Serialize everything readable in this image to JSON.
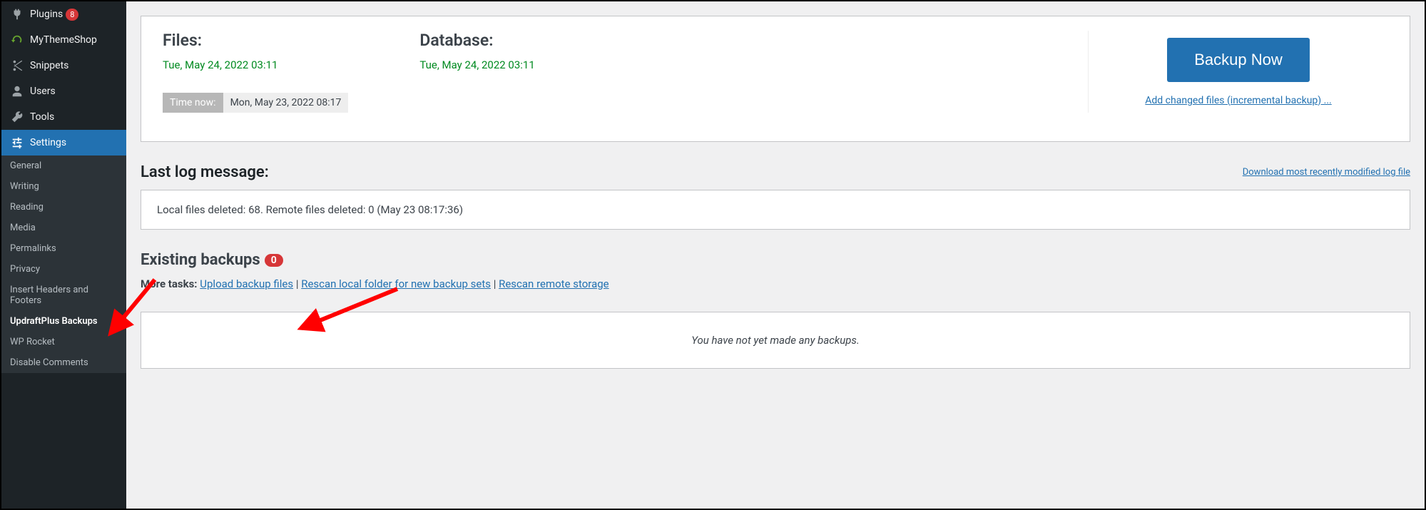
{
  "sidebar": {
    "items": [
      {
        "label": "Plugins",
        "badge": "8",
        "icon": "plugin"
      },
      {
        "label": "MyThemeShop",
        "icon": "refresh"
      },
      {
        "label": "Snippets",
        "icon": "tool"
      },
      {
        "label": "Users",
        "icon": "user"
      },
      {
        "label": "Tools",
        "icon": "wrench"
      },
      {
        "label": "Settings",
        "icon": "sliders"
      }
    ],
    "submenu": [
      {
        "label": "General"
      },
      {
        "label": "Writing"
      },
      {
        "label": "Reading"
      },
      {
        "label": "Media"
      },
      {
        "label": "Permalinks"
      },
      {
        "label": "Privacy"
      },
      {
        "label": "Insert Headers and Footers"
      },
      {
        "label": "UpdraftPlus Backups",
        "current": true
      },
      {
        "label": "WP Rocket"
      },
      {
        "label": "Disable Comments"
      }
    ]
  },
  "schedule": {
    "files_label": "Files:",
    "files_date": "Tue, May 24, 2022 03:11",
    "db_label": "Database:",
    "db_date": "Tue, May 24, 2022 03:11",
    "time_now_label": "Time now:",
    "time_now_value": "Mon, May 23, 2022 08:17"
  },
  "actions": {
    "backup_now": "Backup Now",
    "incremental": "Add changed files (incremental backup) ..."
  },
  "log": {
    "heading": "Last log message:",
    "download_link": "Download most recently modified log file",
    "message": "Local files deleted: 68. Remote files deleted: 0 (May 23 08:17:36)"
  },
  "existing": {
    "heading": "Existing backups",
    "count": "0",
    "more_tasks_label": "More tasks:",
    "upload_link": "Upload backup files",
    "rescan_local_link": "Rescan local folder for new backup sets",
    "rescan_remote_link": "Rescan remote storage",
    "empty_message": "You have not yet made any backups."
  }
}
